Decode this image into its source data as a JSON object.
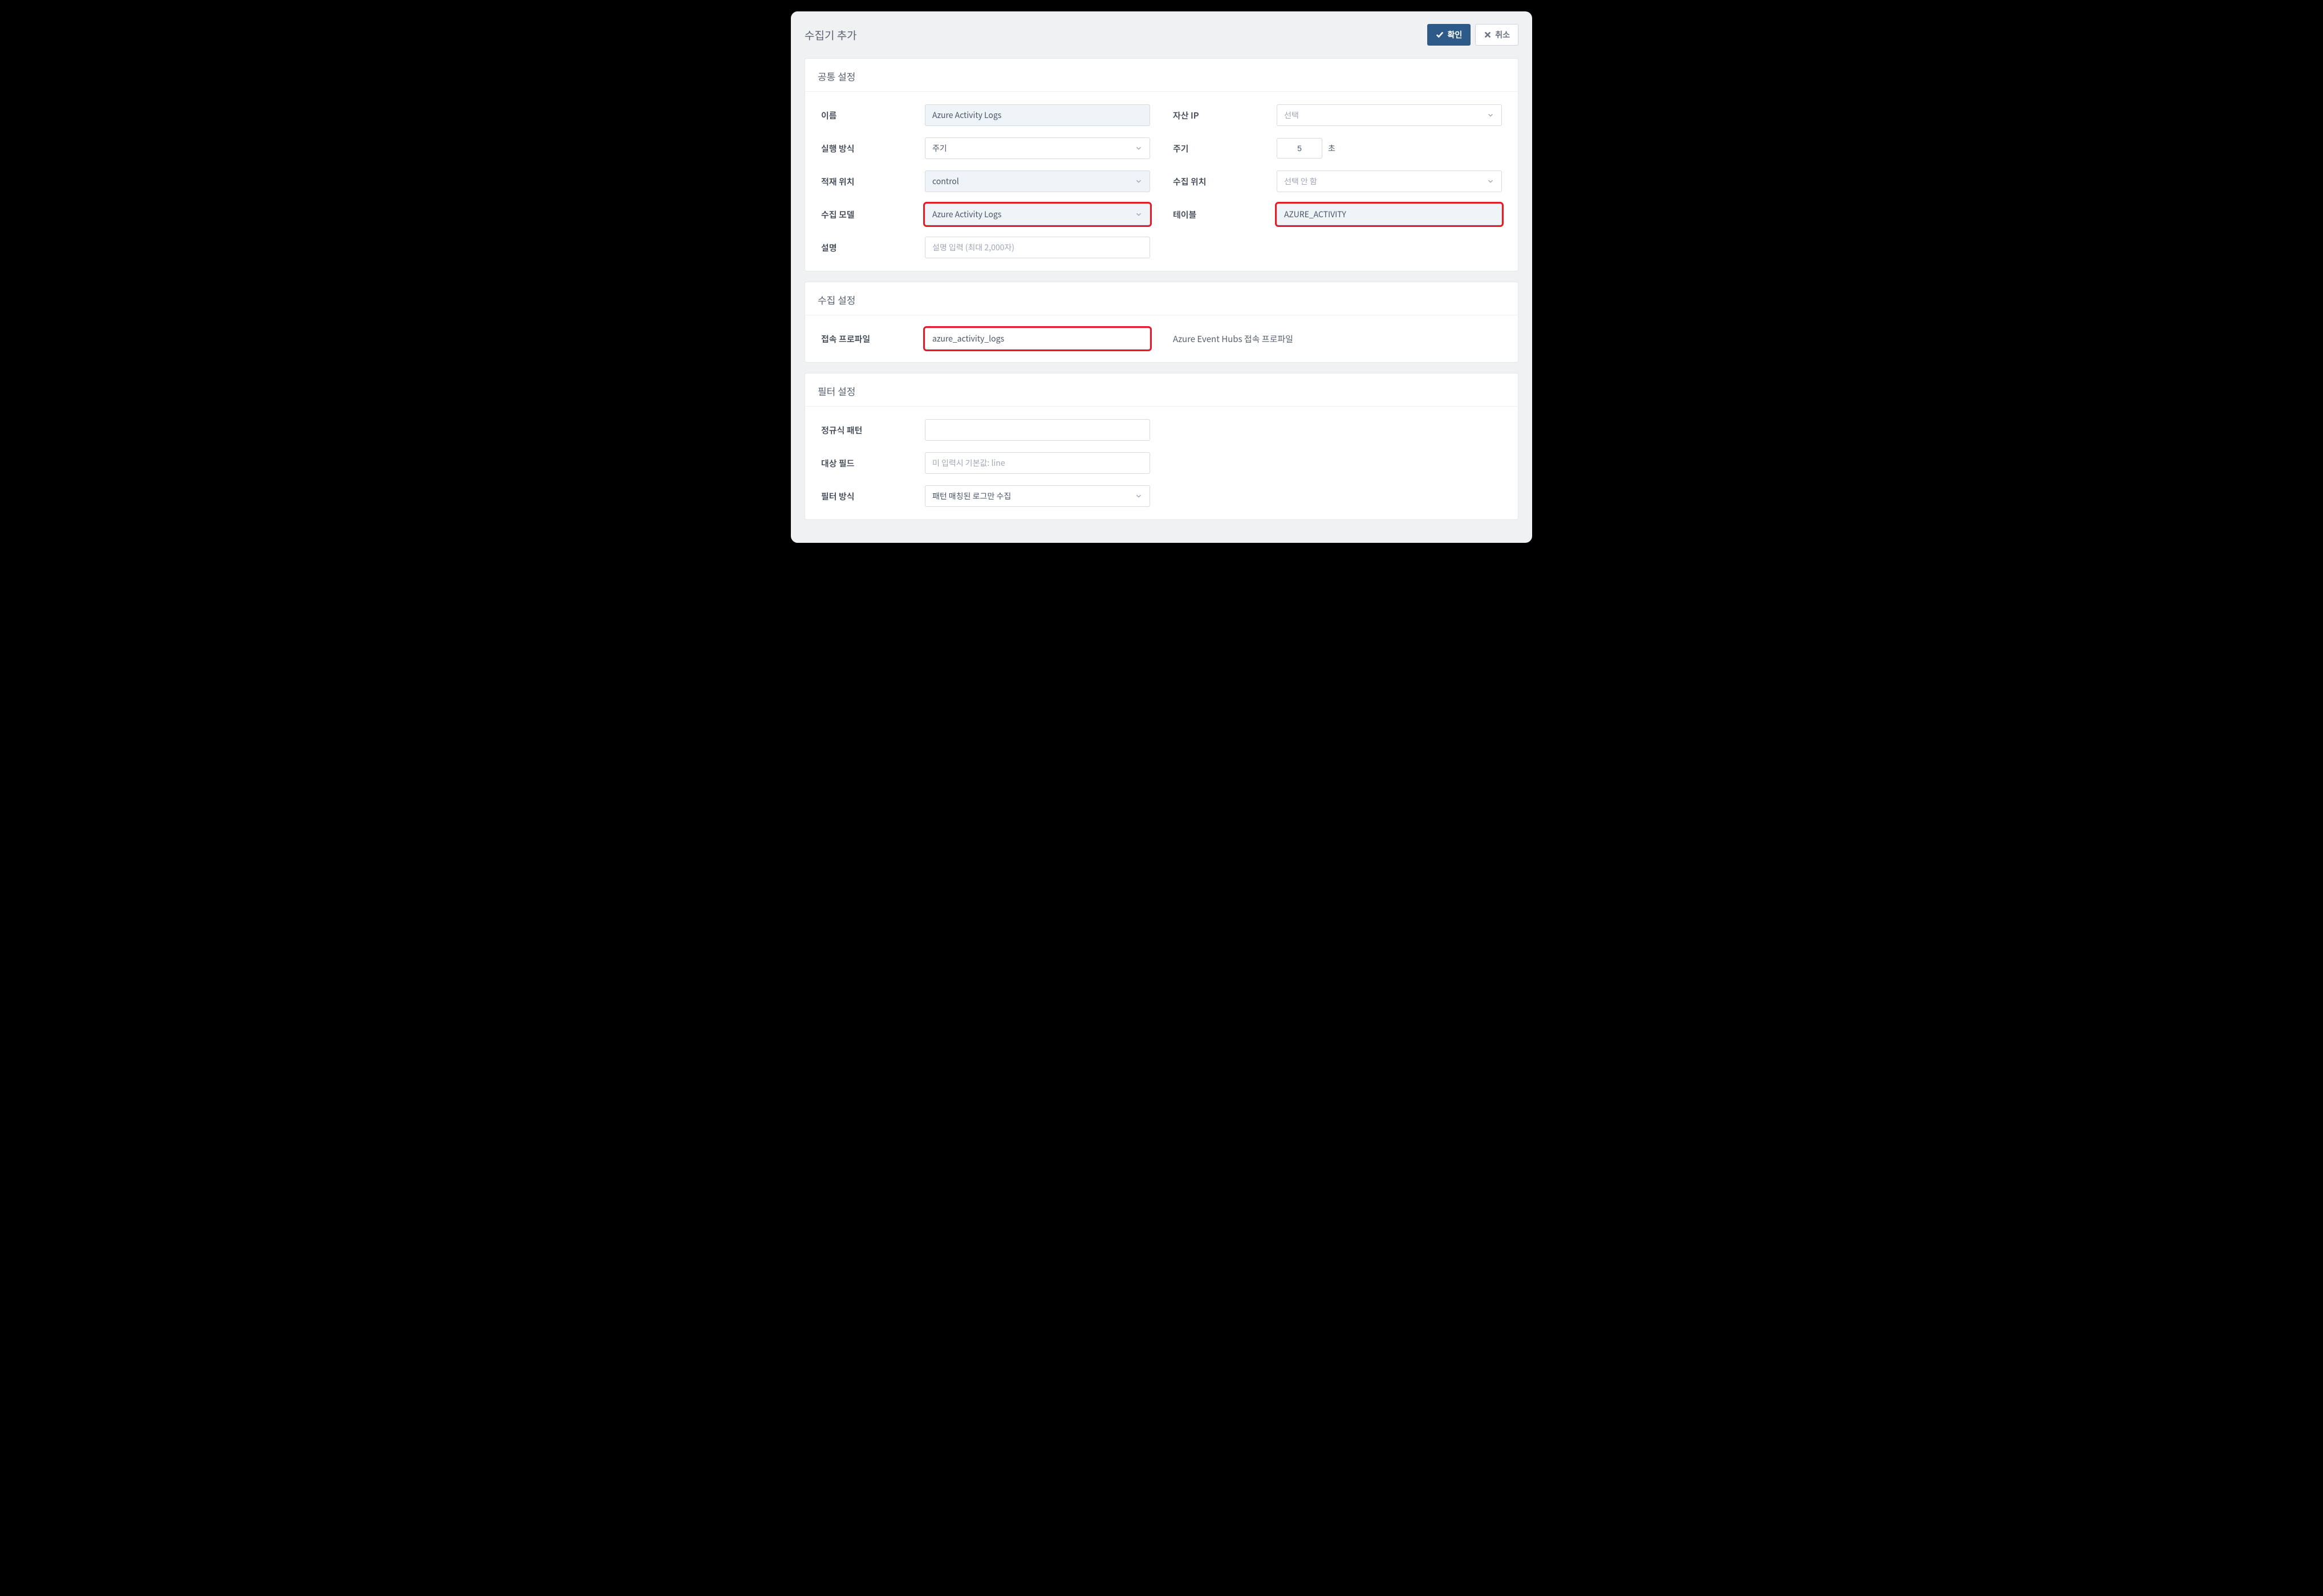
{
  "header": {
    "title": "수집기 추가",
    "confirm_label": "확인",
    "cancel_label": "취소"
  },
  "common": {
    "section_title": "공통 설정",
    "name_label": "이름",
    "name_value": "Azure Activity Logs",
    "run_mode_label": "실행 방식",
    "run_mode_value": "주기",
    "load_loc_label": "적재 위치",
    "load_loc_value": "control",
    "model_label": "수집 모델",
    "model_value": "Azure Activity Logs",
    "desc_label": "설명",
    "desc_placeholder": "설명 입력 (최대 2,000자)",
    "asset_ip_label": "자산 IP",
    "asset_ip_placeholder": "선택",
    "period_label": "주기",
    "period_value": "5",
    "period_unit": "초",
    "collect_loc_label": "수집 위치",
    "collect_loc_placeholder": "선택 안 함",
    "table_label": "테이블",
    "table_value": "AZURE_ACTIVITY"
  },
  "collect": {
    "section_title": "수집 설정",
    "profile_label": "접속 프로파일",
    "profile_value": "azure_activity_logs",
    "profile_desc": "Azure Event Hubs 접속 프로파일"
  },
  "filter": {
    "section_title": "필터 설정",
    "regex_label": "정규식 패턴",
    "target_label": "대상 필드",
    "target_placeholder": "미 입력시 기본값: line",
    "mode_label": "필터 방식",
    "mode_value": "패턴 매칭된 로그만 수집"
  }
}
